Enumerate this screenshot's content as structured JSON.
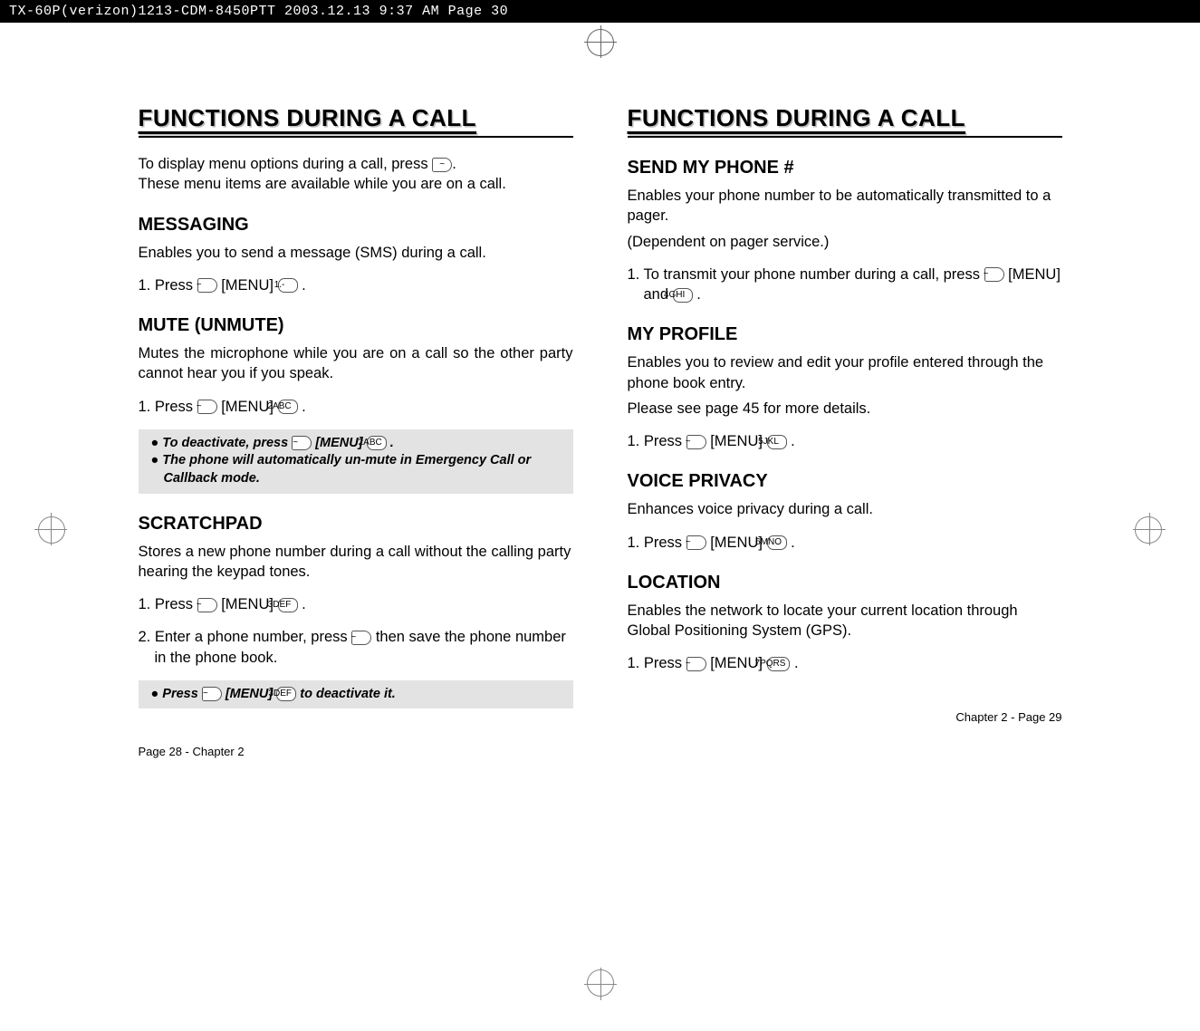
{
  "header": "TX-60P(verizon)1213-CDM-8450PTT  2003.12.13  9:37 AM  Page 30",
  "left": {
    "title": "FUNCTIONS DURING A CALL",
    "intro1": "To display menu options during a call, press      .",
    "intro2": "These menu items are available while you are on a call.",
    "messaging": {
      "heading": "MESSAGING",
      "desc": "Enables you to send a message (SMS) during a call.",
      "step1": "1. Press       [MENU]       ."
    },
    "mute": {
      "heading": "MUTE (UNMUTE)",
      "desc": "Mutes the microphone while you are on a call so the other party cannot hear you if you speak.",
      "step1": "1. Press       [MENU]       .",
      "note1": "● To deactivate, press       [MENU]       .",
      "note2": "● The phone will automatically un-mute in Emergency Call or Callback mode."
    },
    "scratchpad": {
      "heading": "SCRATCHPAD",
      "desc": "Stores a new phone number during a call without the calling party hearing the keypad tones.",
      "step1": "1. Press       [MENU]       .",
      "step2": "2. Enter a phone number, press       then save the phone number in the phone book.",
      "note1": "● Press       [MENU]       to deactivate it."
    },
    "footer": "Page 28 - Chapter 2"
  },
  "right": {
    "title": "FUNCTIONS DURING A CALL",
    "sendphone": {
      "heading": "SEND MY PHONE #",
      "desc1": "Enables your phone number to be automatically transmitted to a pager.",
      "desc2": "(Dependent on pager service.)",
      "step1": "1. To transmit your phone number during a call, press       [MENU] and       ."
    },
    "myprofile": {
      "heading": "MY PROFILE",
      "desc1": "Enables you to review and edit your profile entered through the phone book entry.",
      "desc2": "Please see page 45 for more details.",
      "step1": "1. Press       [MENU]       ."
    },
    "voiceprivacy": {
      "heading": "VOICE PRIVACY",
      "desc": "Enhances voice privacy during a call.",
      "step1": "1. Press       [MENU]       ."
    },
    "location": {
      "heading": "LOCATION",
      "desc": "Enables the network to locate your current location through Global Positioning System (GPS).",
      "step1": "1. Press       [MENU]       ."
    },
    "footer": "Chapter 2 - Page 29"
  },
  "keys": {
    "soft": "~",
    "k1": "1.-",
    "k2": "2ABC",
    "k3": "3DEF",
    "k4": "4GHI",
    "k5": "5JKL",
    "k6": "6MNO",
    "k7": "7PQRS"
  }
}
